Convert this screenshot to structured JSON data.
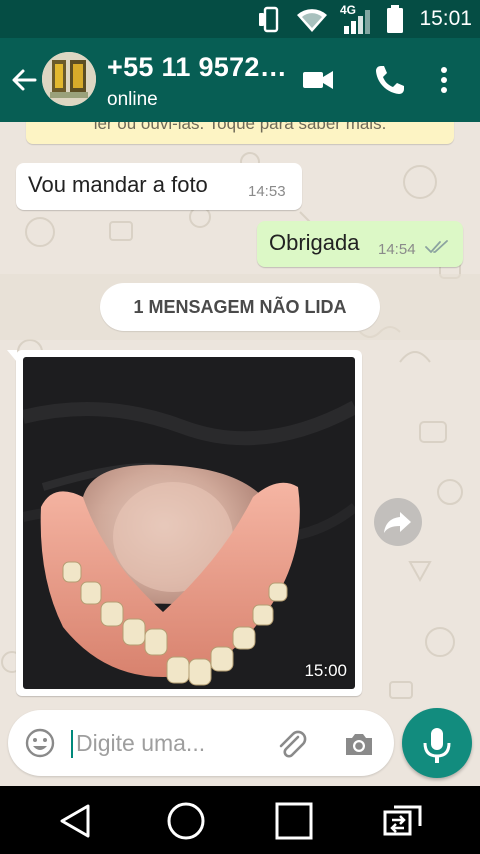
{
  "status_bar": {
    "time": "15:01",
    "network": "4G"
  },
  "header": {
    "title": "+55 11 9572…",
    "subtitle": "online"
  },
  "banner": {
    "text": "ler ou ouvi-las. Toque para saber mais."
  },
  "messages": [
    {
      "direction": "in",
      "text": "Vou mandar a foto",
      "time": "14:53"
    },
    {
      "direction": "out",
      "text": "Obrigada",
      "time": "14:54",
      "status": "read"
    }
  ],
  "unread_divider": {
    "text": "1 MENSAGEM NÃO LIDA"
  },
  "photo_message": {
    "time": "15:00"
  },
  "composer": {
    "placeholder": "Digite uma..."
  },
  "icons": {
    "back": "arrow-left-icon",
    "video": "video-call-icon",
    "call": "phone-icon",
    "menu": "more-vert-icon",
    "emoji": "emoji-icon",
    "attach": "paperclip-icon",
    "camera": "camera-icon",
    "mic": "mic-icon",
    "share": "forward-icon"
  },
  "colors": {
    "header": "#075e54",
    "status_bar": "#054d44",
    "outgoing": "#dcf8c6",
    "accent": "#128c7e"
  }
}
